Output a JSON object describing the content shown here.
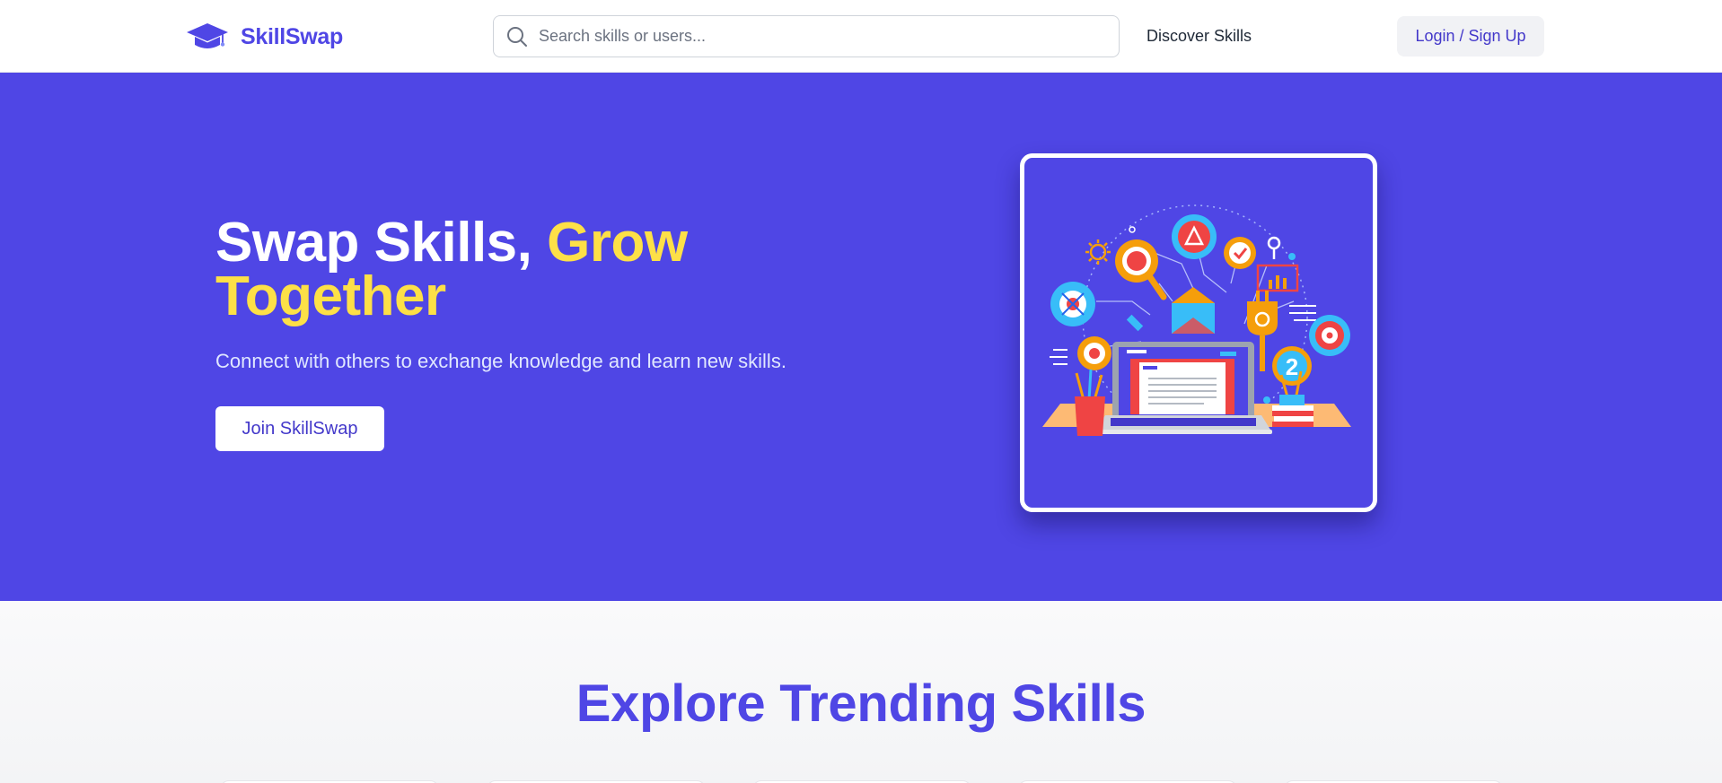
{
  "header": {
    "brand": "SkillSwap",
    "logo_icon": "graduation-cap-icon",
    "search": {
      "placeholder": "Search skills or users...",
      "value": "",
      "icon": "search-icon"
    },
    "nav_discover": "Discover Skills",
    "login_label": "Login / Sign Up"
  },
  "hero": {
    "title_part1": "Swap Skills, ",
    "title_accent": "Grow Together",
    "subtitle": "Connect with others to exchange knowledge and learn new skills.",
    "cta_label": "Join SkillSwap",
    "illustration_icon": "learning-laptop-illustration"
  },
  "trending": {
    "title": "Explore Trending Skills",
    "cards": [
      {},
      {},
      {},
      {},
      {}
    ]
  },
  "colors": {
    "brand": "#4f46e5",
    "accent": "#fde047",
    "button_text": "#4338ca"
  }
}
